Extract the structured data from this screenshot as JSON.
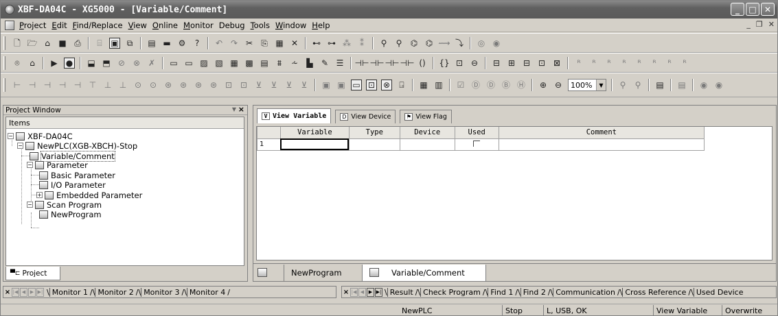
{
  "window": {
    "title": "XBF-DA04C - XG5000 - [Variable/Comment]"
  },
  "menu": {
    "items": [
      {
        "label": "Project",
        "u": "P"
      },
      {
        "label": "Edit",
        "u": "E"
      },
      {
        "label": "Find/Replace",
        "u": "F"
      },
      {
        "label": "View",
        "u": "V"
      },
      {
        "label": "Online",
        "u": "O"
      },
      {
        "label": "Monitor",
        "u": "M"
      },
      {
        "label": "Debug",
        "u": "g"
      },
      {
        "label": "Tools",
        "u": "T"
      },
      {
        "label": "Window",
        "u": "W"
      },
      {
        "label": "Help",
        "u": "H"
      }
    ]
  },
  "toolbar": {
    "zoom_value": "100%"
  },
  "project_window": {
    "title": "Project Window",
    "tree_header": "Items",
    "tab_label": "Project",
    "tree": {
      "root": "XBF-DA04C",
      "plc": "NewPLC(XGB-XBCH)-Stop",
      "variable_comment": "Variable/Comment",
      "parameter": "Parameter",
      "basic_parameter": "Basic Parameter",
      "io_parameter": "I/O Parameter",
      "embedded_parameter": "Embedded Parameter",
      "scan_program": "Scan Program",
      "new_program": "NewProgram"
    }
  },
  "variable_view": {
    "tabs": [
      "View Variable",
      "View Device",
      "View Flag"
    ],
    "columns": [
      "Variable",
      "Type",
      "Device",
      "Used",
      "Comment"
    ],
    "rows": [
      {
        "num": "1",
        "variable": "",
        "type": "",
        "device": "",
        "comment": ""
      }
    ]
  },
  "editor_tabs": [
    "NewProgram",
    "Variable/Comment"
  ],
  "monitor_tabs": [
    "Monitor 1",
    "Monitor 2",
    "Monitor 3",
    "Monitor 4"
  ],
  "result_tabs": [
    "Result",
    "Check Program",
    "Find 1",
    "Find 2",
    "Communication",
    "Cross Reference",
    "Used Device"
  ],
  "status": {
    "plc": "NewPLC",
    "mode": "Stop",
    "connection": "L, USB, OK",
    "view": "View Variable",
    "edit_mode": "Overwrite"
  }
}
